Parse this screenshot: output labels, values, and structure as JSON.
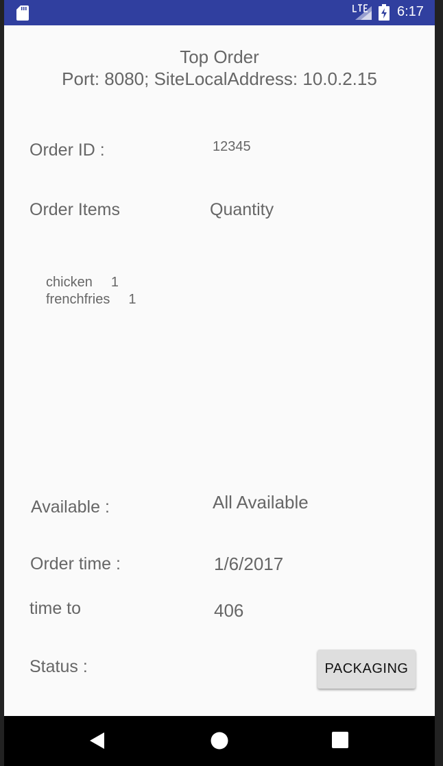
{
  "status_bar": {
    "time": "6:17",
    "network": "LTE"
  },
  "header": {
    "title": "Top Order",
    "subtitle": "Port: 8080; SiteLocalAddress: 10.0.2.15"
  },
  "order": {
    "id_label": "Order ID :",
    "id_value": "12345",
    "items_header": "Order Items",
    "quantity_header": "Quantity",
    "items": [
      {
        "name": "chicken",
        "qty": "1"
      },
      {
        "name": "frenchfries",
        "qty": "1"
      }
    ],
    "available_label": "Available :",
    "available_value": "All Available",
    "order_time_label": "Order time :",
    "order_time_value": "1/6/2017",
    "time_to_label": "time to",
    "time_to_value": "406",
    "status_label": "Status :",
    "status_button": "PACKAGING"
  },
  "colors": {
    "status_bar": "#303f9f",
    "background": "#fafafa",
    "text": "#666666",
    "button": "#dedede"
  },
  "icons": [
    "sd-card-icon",
    "lte-signal-icon",
    "battery-charging-icon",
    "back-icon",
    "home-icon",
    "recents-icon"
  ]
}
